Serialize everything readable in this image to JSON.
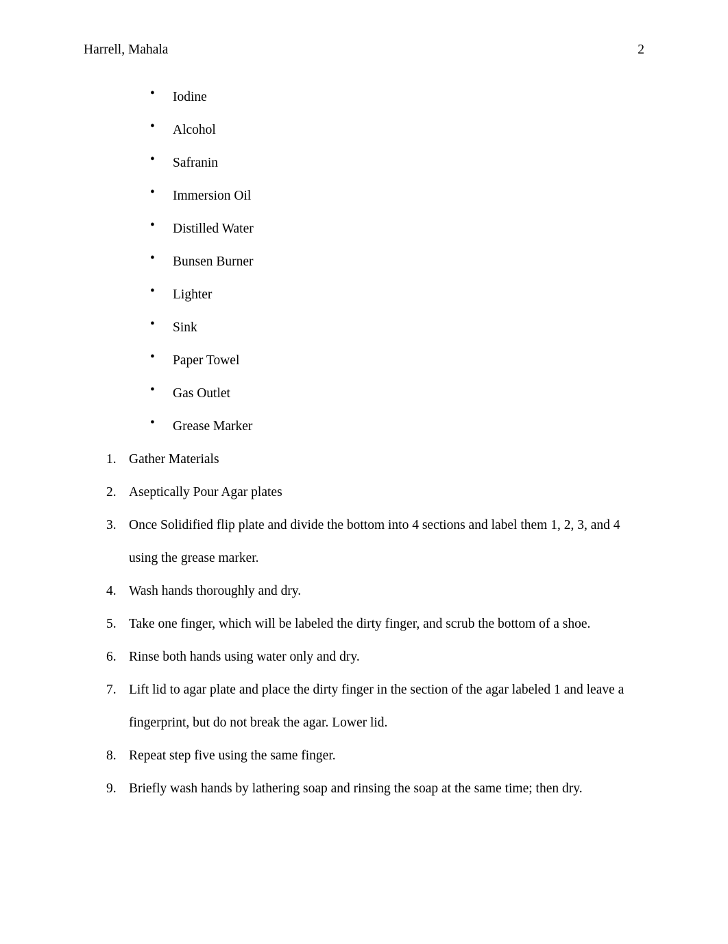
{
  "document": {
    "page_background": "#ffffff",
    "text_color": "#000000"
  },
  "header": {
    "name": "Harrell, Mahala",
    "page_number": "2"
  },
  "materials_list": {
    "bullet_glyph": "•",
    "items": [
      {
        "label": "Iodine"
      },
      {
        "label": "Alcohol"
      },
      {
        "label": "Safranin"
      },
      {
        "label": "Immersion Oil"
      },
      {
        "label": "Distilled Water"
      },
      {
        "label": "Bunsen Burner"
      },
      {
        "label": "Lighter"
      },
      {
        "label": "Sink"
      },
      {
        "label": "Paper Towel"
      },
      {
        "label": "Gas Outlet"
      },
      {
        "label": "Grease Marker"
      }
    ]
  },
  "procedure_list": {
    "items": [
      {
        "number": "1.",
        "text": "Gather Materials"
      },
      {
        "number": "2.",
        "text": "Aseptically Pour Agar plates"
      },
      {
        "number": "3.",
        "text": "Once Solidified flip plate and divide the bottom into 4 sections and label them 1, 2, 3, and 4 using the grease marker."
      },
      {
        "number": "4.",
        "text": "Wash hands thoroughly and dry."
      },
      {
        "number": "5.",
        "text": "Take one finger, which will be labeled the dirty finger, and scrub the bottom of a shoe."
      },
      {
        "number": "6.",
        "text": "Rinse both hands using water only and dry."
      },
      {
        "number": "7.",
        "text": "Lift lid to agar plate and place the dirty finger in the section of the agar labeled 1 and leave a fingerprint, but do not break the agar. Lower lid."
      },
      {
        "number": "8.",
        "text": "Repeat step five using the same finger."
      },
      {
        "number": "9.",
        "text": "Briefly wash hands by lathering soap and rinsing the soap at the same time; then dry."
      }
    ]
  }
}
